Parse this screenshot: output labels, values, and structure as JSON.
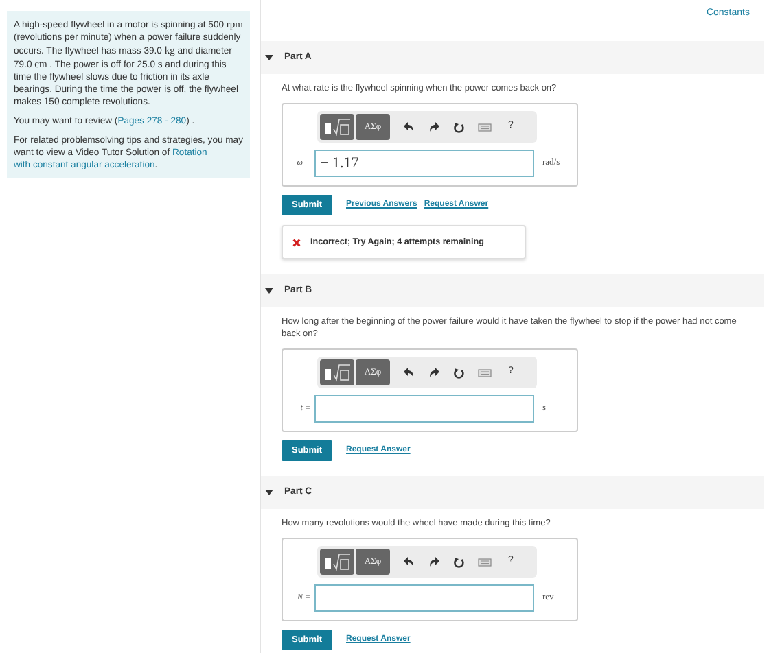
{
  "problem": {
    "paragraphs": [
      [
        {
          "kind": "text",
          "text": "A high-speed flywheel in a motor is spinning at 500 "
        },
        {
          "kind": "unit",
          "text": "rpm"
        },
        {
          "kind": "text",
          "text": " (revolutions per minute) when a power failure suddenly occurs. The flywheel has mass 39.0 "
        },
        {
          "kind": "unit",
          "text": "kg"
        },
        {
          "kind": "text",
          "text": " and diameter 79.0 "
        },
        {
          "kind": "unit",
          "text": "cm"
        },
        {
          "kind": "text",
          "text": " . The power is off for 25.0 s and during this time the flywheel slows due to friction in its axle bearings. During the time the power is off, the flywheel makes 150 complete revolutions."
        }
      ],
      [
        {
          "kind": "text",
          "text": "You may want to review ("
        },
        {
          "kind": "link",
          "text": "Pages 278 - 280"
        },
        {
          "kind": "text",
          "text": ") ."
        }
      ],
      [
        {
          "kind": "text",
          "text": "For related problemsolving tips and strategies, you may want to view a Video Tutor Solution of "
        },
        {
          "kind": "link",
          "text": "Rotation"
        },
        {
          "kind": "link",
          "text": "with constant angular acceleration"
        },
        {
          "kind": "text",
          "text": "."
        }
      ]
    ]
  },
  "constants_link": "Constants",
  "parts": [
    {
      "label": "Part A",
      "expanded": true,
      "question": "At what rate is the flywheel spinning when the power comes back on?",
      "toolbar": {
        "symbols": "ΑΣφ",
        "help": "?"
      },
      "variable": "ω =",
      "value": "− 1.17",
      "unit": "rad/s",
      "submit": "Submit",
      "links": [
        "Previous Answers",
        "Request Answer"
      ],
      "feedback": {
        "kind": "incorrect",
        "text": "Incorrect; Try Again; 4 attempts remaining"
      }
    },
    {
      "label": "Part B",
      "expanded": true,
      "question": "How long after the beginning of the power failure would it have taken the flywheel to stop if the power had not come back on?",
      "toolbar": {
        "symbols": "ΑΣφ",
        "help": "?"
      },
      "variable": "t =",
      "unit": "s",
      "submit": "Submit",
      "links": [
        "Request Answer"
      ]
    },
    {
      "label": "Part C",
      "expanded": true,
      "question": "How many revolutions would the wheel have made during this time?",
      "toolbar": {
        "symbols": "ΑΣφ",
        "help": "?"
      },
      "variable": "N =",
      "unit": "rev",
      "submit": "Submit",
      "links": [
        "Request Answer"
      ]
    }
  ]
}
